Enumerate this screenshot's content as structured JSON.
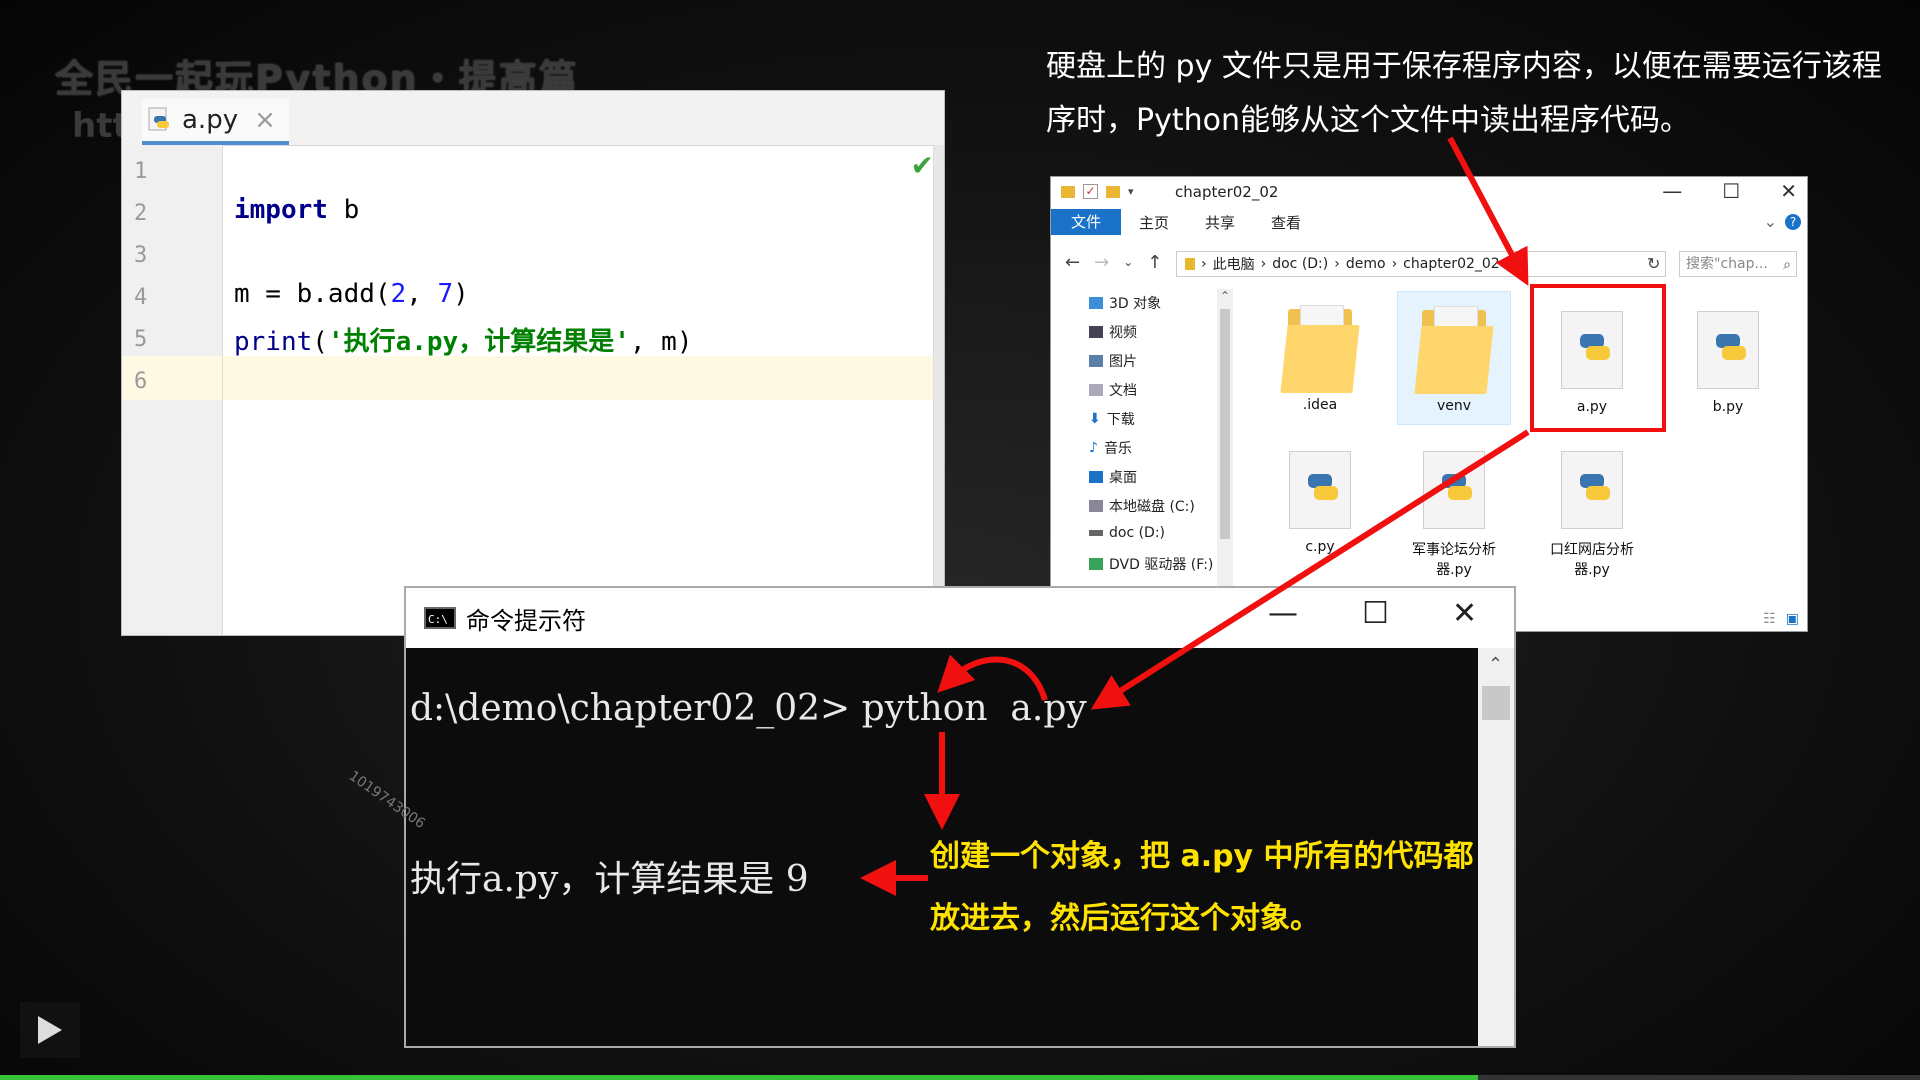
{
  "video": {
    "watermark_title": "全民一起玩Python・提高篇",
    "watermark_url": "htt",
    "stamp_id": "1019743006",
    "progress": 0.77
  },
  "editor": {
    "tab_label": "a.py",
    "line_numbers": [
      "1",
      "2",
      "3",
      "4",
      "5",
      "6"
    ],
    "code": {
      "l2_kw": "import",
      "l2_rest": " b",
      "l4_a": "m = b.add(",
      "l4_n1": "2",
      "l4_b": ", ",
      "l4_n2": "7",
      "l4_c": ")",
      "l5_fn": "print",
      "l5_open": "(",
      "l5_str": "'执行a.py，计算结果是'",
      "l5_rest": ", m)"
    }
  },
  "explain_top": "硬盘上的 py 文件只是用于保存程序内容，以便在需要运行该程序时，Python能够从这个文件中读出程序代码。",
  "explorer": {
    "title": "chapter02_02",
    "ribbon": [
      "文件",
      "主页",
      "共享",
      "查看"
    ],
    "breadcrumb": [
      "此电脑",
      "doc (D:)",
      "demo",
      "chapter02_02"
    ],
    "search_placeholder": "搜索\"chap...",
    "nav_items": [
      "3D 对象",
      "视频",
      "图片",
      "文档",
      "下载",
      "音乐",
      "桌面",
      "本地磁盘 (C:)",
      "doc (D:)",
      "DVD 驱动器 (F:)"
    ],
    "files": [
      ".idea",
      "venv",
      "a.py",
      "b.py",
      "c.py",
      "军事论坛分析器.py",
      "口红网店分析器.py"
    ]
  },
  "cmd": {
    "title": "命令提示符",
    "prompt_line": "d:\\demo\\chapter02_02> python  a.py",
    "output_line": "执行a.py，计算结果是 9"
  },
  "explain_cmd": "创建一个对象，把 a.py 中所有的代码都放进去，然后运行这个对象。",
  "colors": {
    "arrow": "#f01010",
    "highlight_text": "#ffe200",
    "progress": "#36c236"
  }
}
